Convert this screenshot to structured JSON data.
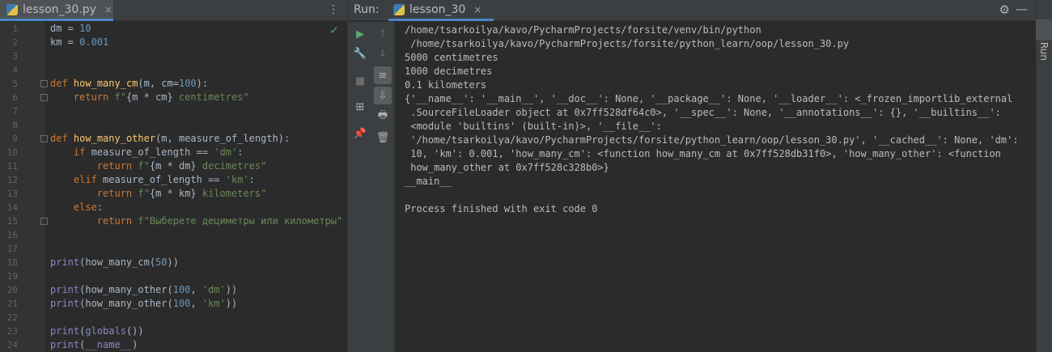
{
  "editor": {
    "tab": {
      "filename": "lesson_30.py",
      "close": "×"
    },
    "menu": "⋮",
    "gutter": [
      "1",
      "2",
      "3",
      "4",
      "5",
      "6",
      "7",
      "8",
      "9",
      "10",
      "11",
      "12",
      "13",
      "14",
      "15",
      "16",
      "17",
      "18",
      "19",
      "20",
      "21",
      "22",
      "23",
      "24"
    ],
    "lines": [
      {
        "y": 0,
        "html": "dm = <span class='num'>10</span>"
      },
      {
        "y": 1,
        "html": "km = <span class='num'>0.001</span>"
      },
      {
        "y": 4,
        "html": "<span class='kw'>def</span> <span class='fn'>how_many_cm</span>(m, cm=<span class='num'>100</span>):"
      },
      {
        "y": 5,
        "html": "    <span class='kw'>return</span> <span class='str'>f\"</span>{m * cm}<span class='str'> centimetres\"</span>"
      },
      {
        "y": 8,
        "html": "<span class='kw'>def</span> <span class='fn'>how_many_other</span>(m, measure_of_length):"
      },
      {
        "y": 9,
        "html": "    <span class='kw'>if</span> measure_of_length == <span class='str'>'dm'</span>:"
      },
      {
        "y": 10,
        "html": "        <span class='kw'>return</span> <span class='str'>f\"</span>{m * dm}<span class='str'> decimetres\"</span>"
      },
      {
        "y": 11,
        "html": "    <span class='kw'>elif</span> measure_of_length == <span class='str'>'km'</span>:"
      },
      {
        "y": 12,
        "html": "        <span class='kw'>return</span> <span class='str'>f\"</span>{m * km}<span class='str'> kilometers\"</span>"
      },
      {
        "y": 13,
        "html": "    <span class='kw'>else</span>:"
      },
      {
        "y": 14,
        "html": "        <span class='kw'>return</span> <span class='str'>f\"Выберете дециметры или километры\"</span>"
      },
      {
        "y": 17,
        "html": "<span class='bi'>print</span>(how_many_cm(<span class='num'>50</span>))"
      },
      {
        "y": 19,
        "html": "<span class='bi'>print</span>(how_many_other(<span class='num'>100</span>, <span class='str'>'dm'</span>))"
      },
      {
        "y": 20,
        "html": "<span class='bi'>print</span>(how_many_other(<span class='num'>100</span>, <span class='str'>'km'</span>))"
      },
      {
        "y": 22,
        "html": "<span class='bi'>print</span>(<span class='bi'>globals</span>())"
      },
      {
        "y": 23,
        "html": "<span class='bi'>print</span>(<span class='bi'>__name__</span>)"
      }
    ]
  },
  "run": {
    "label": "Run:",
    "tab": "lesson_30",
    "tab_close": "×",
    "gear": "⚙",
    "minimize": "—",
    "side_label": "Run",
    "toolbar": [
      "▶",
      "🔧",
      "■",
      "⊞",
      "📌",
      "↑",
      "↓",
      "≡",
      "⇩",
      "🖶",
      "🗑"
    ],
    "output": [
      "/home/tsarkoilya/kavo/PycharmProjects/forsite/venv/bin/python",
      " /home/tsarkoilya/kavo/PycharmProjects/forsite/python_learn/oop/lesson_30.py",
      "5000 centimetres",
      "1000 decimetres",
      "0.1 kilometers",
      "{'__name__': '__main__', '__doc__': None, '__package__': None, '__loader__': <_frozen_importlib_external",
      " .SourceFileLoader object at 0x7ff528df64c0>, '__spec__': None, '__annotations__': {}, '__builtins__':",
      " <module 'builtins' (built-in)>, '__file__':",
      " '/home/tsarkoilya/kavo/PycharmProjects/forsite/python_learn/oop/lesson_30.py', '__cached__': None, 'dm':",
      " 10, 'km': 0.001, 'how_many_cm': <function how_many_cm at 0x7ff528db31f0>, 'how_many_other': <function",
      " how_many_other at 0x7ff528c328b0>}",
      "__main__",
      "",
      "Process finished with exit code 0"
    ]
  }
}
